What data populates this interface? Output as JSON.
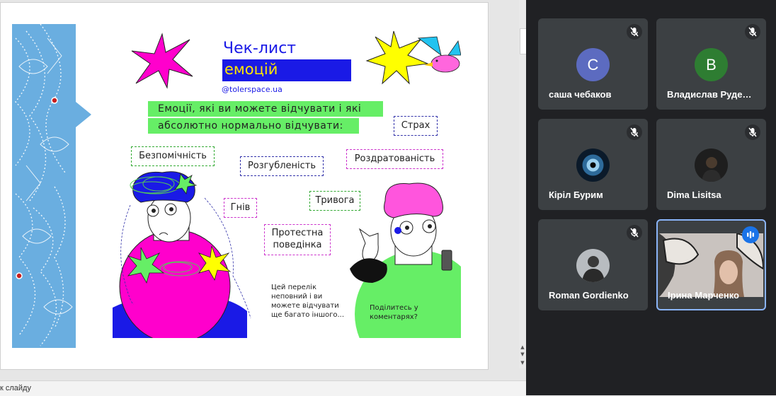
{
  "presentation": {
    "notes_placeholder": "к слайду"
  },
  "slide": {
    "title_line1": "Чек-лист",
    "title_line2": "емоцій",
    "handle": "@tolerspace.ua",
    "intro_line1": "Емоції, які ви можете відчувати і які",
    "intro_line2": "абсолютно нормально відчувати:",
    "emotions": [
      "Страх",
      "Безпомічність",
      "Розгубленість",
      "Роздратованість",
      "Гнів",
      "Тривога"
    ],
    "protest_line1": "Протестна",
    "protest_line2": "поведінка",
    "note_lines": [
      "Цей перелік",
      "неповний і ви",
      "можете відчувати",
      "ще багато іншого..."
    ],
    "share_lines": [
      "Поділитесь у",
      "коментарях?"
    ],
    "colors": {
      "blue_panel": "#6aaee0",
      "title_blue": "#1a1ae6",
      "title_yellow": "#ffe600",
      "green": "#66ee66",
      "magenta": "#ff00cc",
      "pink_hair": "#ff55dd"
    }
  },
  "meet": {
    "participants": [
      {
        "name": "саша чебаков",
        "initial": "С",
        "avatar_color": "#5c6bc0",
        "muted": true
      },
      {
        "name": "Владислав Руде…",
        "initial": "В",
        "avatar_color": "#2e7d32",
        "muted": true
      },
      {
        "name": "Кіріл Бурим",
        "avatar": "eye-photo",
        "muted": true
      },
      {
        "name": "Dima Lisitsa",
        "avatar": "dark-photo",
        "muted": true
      },
      {
        "name": "Roman Gordienko",
        "avatar": "person-photo",
        "muted": true
      },
      {
        "name": "Ірина Марченко",
        "avatar": "camera-video",
        "speaking": true
      }
    ]
  }
}
